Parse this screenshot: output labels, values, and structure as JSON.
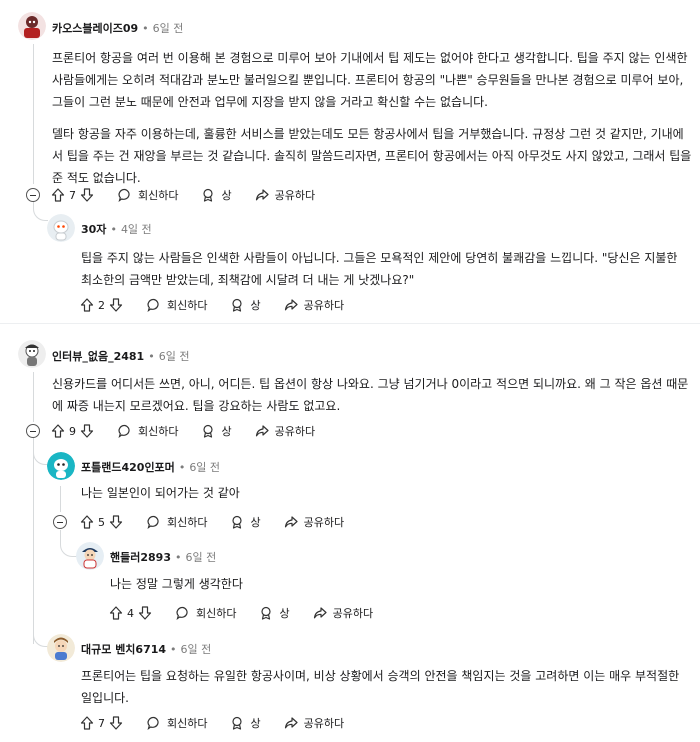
{
  "labels": {
    "reply": "회신하다",
    "award": "상",
    "share": "공유하다",
    "dot": "•"
  },
  "comments": [
    {
      "user": "카오스블레이즈09",
      "time": "6일 전",
      "votes": "7",
      "paragraphs": [
        "프론티어 항공을 여러 번 이용해 본 경험으로 미루어 보아 기내에서 팁 제도는 없어야 한다고 생각합니다. 팁을 주지 않는 인색한 사람들에게는 오히려 적대감과 분노만 불러일으킬 뿐입니다. 프론티어 항공의 \"나쁜\" 승무원들을 만나본 경험으로 미루어 보아, 그들이 그런 분노 때문에 안전과 업무에 지장을 받지 않을 거라고 확신할 수는 없습니다.",
        "델타 항공을 자주 이용하는데, 훌륭한 서비스를 받았는데도 모든 항공사에서 팁을 거부했습니다. 규정상 그런 것 같지만, 기내에서 팁을 주는 건 재앙을 부르는 것 같습니다. 솔직히 말씀드리자면, 프론티어 항공에서는 아직 아무것도 사지 않았고, 그래서 팁을 준 적도 없습니다."
      ]
    },
    {
      "user": "30자",
      "time": "4일 전",
      "votes": "2",
      "paragraphs": [
        "팁을 주지 않는 사람들은 인색한 사람들이 아닙니다. 그들은 모욕적인 제안에 당연히 불쾌감을 느낍니다. \"당신은 지불한 최소한의 금액만 받았는데, 죄책감에 시달려 더 내는 게 낫겠나요?\""
      ]
    },
    {
      "user": "인터뷰_없음_2481",
      "time": "6일 전",
      "votes": "9",
      "paragraphs": [
        "신용카드를 어디서든 쓰면, 아니, 어디든. 팁 옵션이 항상 나와요. 그냥 넘기거나 0이라고 적으면 되니까요. 왜 그 작은 옵션 때문에 짜증 내는지 모르겠어요. 팁을 강요하는 사람도 없고요."
      ]
    },
    {
      "user": "포틀랜드420인포머",
      "time": "6일 전",
      "votes": "5",
      "paragraphs": [
        "나는 일본인이 되어가는 것 같아"
      ]
    },
    {
      "user": "핸들러2893",
      "time": "6일 전",
      "votes": "4",
      "paragraphs": [
        "나는 정말 그렇게 생각한다"
      ]
    },
    {
      "user": "대규모 벤치6714",
      "time": "6일 전",
      "votes": "7",
      "paragraphs": [
        "프론티어는 팁을 요청하는 유일한 항공사이며, 비상 상황에서 승객의 안전을 책임지는 것을 고려하면 이는 매우 부적절한 일입니다."
      ]
    }
  ]
}
